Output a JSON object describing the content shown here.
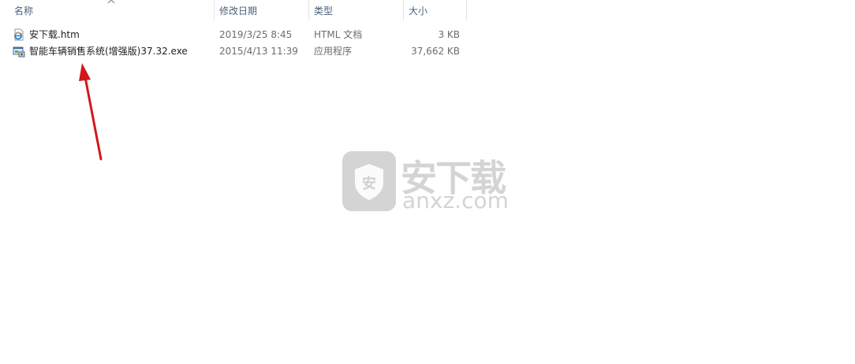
{
  "columns": {
    "name": "名称",
    "date": "修改日期",
    "type": "类型",
    "size": "大小"
  },
  "files": [
    {
      "name": "安下载.htm",
      "date": "2019/3/25 8:45",
      "type": "HTML 文档",
      "size": "3 KB",
      "icon": "html-document-icon"
    },
    {
      "name": "智能车辆销售系统(增强版)37.32.exe",
      "date": "2015/4/13 11:39",
      "type": "应用程序",
      "size": "37,662 KB",
      "icon": "application-exe-icon"
    }
  ],
  "watermark": {
    "cn": "安下载",
    "en": "anxz.com",
    "badge": "安"
  },
  "colors": {
    "header_text": "#4c607a",
    "arrow": "#d2181c",
    "watermark": "#d4d4d4"
  }
}
